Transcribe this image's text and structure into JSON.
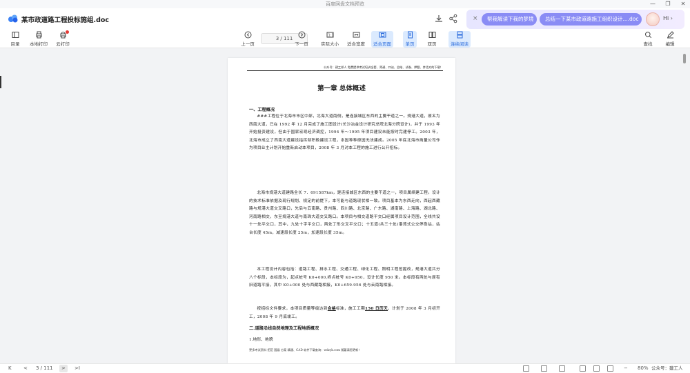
{
  "window": {
    "title": "百度网盘文档预览",
    "controls": [
      "—",
      "❐",
      "✕"
    ]
  },
  "header": {
    "doc_title": "某市政道路工程投标施组.doc",
    "ai": {
      "close": "×",
      "chip1": "帮我解读下我的梦境",
      "chip2": "总结一下某市政道路施工组织设计....doc",
      "hi": "Hi ›"
    }
  },
  "toolbar": {
    "catalog": "目录",
    "local_print": "本地打印",
    "cloud_print": "云打印",
    "prev_page": "上一页",
    "page_indicator": "3 / 111",
    "next_page": "下一页",
    "actual_size": "实际大小",
    "fit_width": "适合宽度",
    "fit_page": "适合页面",
    "single_page": "单页",
    "double_page": "双页",
    "continuous": "连续阅读",
    "find": "查找",
    "edit": "编辑"
  },
  "page": {
    "header_text": "公众号：建工邦人  免费提供考试培训全套、背诵、口诀、总结、试卷、押题、并话对的下载！",
    "chapter": "第一章  总体概述",
    "sec1": "一、工程概况",
    "p1": "###工程位于北海市市区中部，北海大道南侧，是连接城区东西的主要干道之一。规港大道，原名为西南大道，已在 1992 年 12 月完成了施工图设计(长沙冶金设计研究总院北海分院设计)，并于 1993 年开始投资建设，但由于国家宏观经济调控，1994 年～1995 年项目建设未能按时完建停工。2003 年，北海市成立了西南大道建设指挥部积极建设工程，本因种种原因无法建成。2005 年底北海市商量公司作为项目业主计划开始重新启动本项目，2008 年 3 月对本工程的施工进行公开招标。",
    "p2": "北海市规港大道建路全长 7．691587km，是连接城区东西的主要干道之一，项目属续建工程。设计的技术标准依据及现行规划、规定的前提下，本可能与道路现状相一致。项目基本为东西走向，西起西藏路与规港大道交叉路口，先后与云南路、贵州路、四川路、北京路、广东路、湖南路、上海路、湖北路、河南路相交，东至规港大道与南珠大道交叉路口。本项目与相交道路平交口经属项目设计范围，全线共设十一处平交口，其中，九处十字平交口，两处丁形交叉平交口；十五道(共三十处)港湾式公交停靠站，站台长度 45m，减速段长度 25m，加速段长度 35m。",
    "p3": "本工程设计内容包括：道路工程、排水工程、交通工程、绿化工程、照明工程挖掘改，规港大道共分八个标段，本标段为，起点桩号 K0+000,终点桩号 K0+950，设计长度 950 米。本标段有两处与原有旧道路平接，其中 K0+000 处与西藏路相接，K0+659.956 处与云南路相接。",
    "p4_a": "按招标文件要求，本项目质量等级达到",
    "p4_u1": "合格",
    "p4_b": "标准，施工工期",
    "p4_u2": "150 日历天",
    "p4_c": "，计划于 2008 年 3 月初开工，2008 年 9 月底竣工。",
    "sec2": "二.道路沿线自然地理及工程地质概况",
    "sub1": "1.地形、地貌",
    "footer_text": "更多考试资料  招范  国展  方案  精通、CAD 软件下载查询：wdzyk.com  随着请您更新！"
  },
  "statusbar": {
    "page_indicator": "3 / 111",
    "zoom": "80%",
    "watermark": "公众号：建工人",
    "first": "K",
    "prev": "<",
    "next": ">",
    "last": ">I"
  }
}
